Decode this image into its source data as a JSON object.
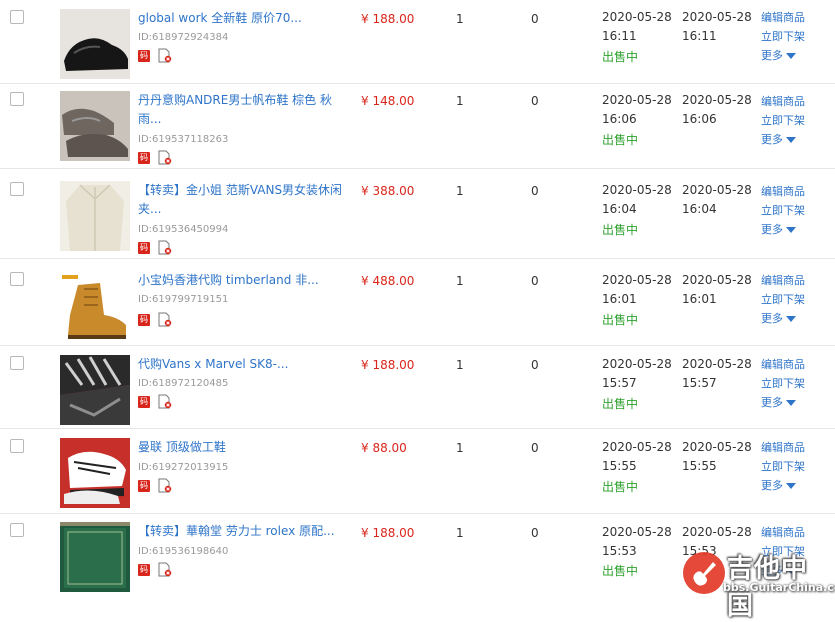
{
  "colors": {
    "link": "#2e74c9",
    "price": "#d9261c",
    "status": "#2ea12e",
    "id": "#9a9a9a",
    "badge": "#d9261c"
  },
  "icons": {
    "badge": "code-badge-icon",
    "docx": "document-delete-icon",
    "more": "chevron-down-icon"
  },
  "badge_text": "码",
  "rows": [
    {
      "title_line1": "global work 全新鞋 原价70...",
      "title_line2": "",
      "id": "ID:618972924384",
      "price": "¥ 188.00",
      "qty": "1",
      "sold": "0",
      "created_date": "2020-05-28",
      "created_time": "16:11",
      "updated_date": "2020-05-28",
      "updated_time": "16:11",
      "status": "出售中",
      "op_edit": "编辑商品",
      "op_offshelf": "立即下架",
      "op_more": "更多"
    },
    {
      "title_line1": "丹丹意购ANDRE男士帆布鞋 棕色 秋",
      "title_line2": "雨...",
      "id": "ID:619537118263",
      "price": "¥ 148.00",
      "qty": "1",
      "sold": "0",
      "created_date": "2020-05-28",
      "created_time": "16:06",
      "updated_date": "2020-05-28",
      "updated_time": "16:06",
      "status": "出售中",
      "op_edit": "编辑商品",
      "op_offshelf": "立即下架",
      "op_more": "更多"
    },
    {
      "title_line1": "【转卖】金小姐 范斯VANS男女装休闲",
      "title_line2": "夹...",
      "id": "ID:619536450994",
      "price": "¥ 388.00",
      "qty": "1",
      "sold": "0",
      "created_date": "2020-05-28",
      "created_time": "16:04",
      "updated_date": "2020-05-28",
      "updated_time": "16:04",
      "status": "出售中",
      "op_edit": "编辑商品",
      "op_offshelf": "立即下架",
      "op_more": "更多"
    },
    {
      "title_line1": "小宝妈香港代购 timberland 非...",
      "title_line2": "",
      "id": "ID:619799719151",
      "price": "¥ 488.00",
      "qty": "1",
      "sold": "0",
      "created_date": "2020-05-28",
      "created_time": "16:01",
      "updated_date": "2020-05-28",
      "updated_time": "16:01",
      "status": "出售中",
      "op_edit": "编辑商品",
      "op_offshelf": "立即下架",
      "op_more": "更多"
    },
    {
      "title_line1": "代购Vans x Marvel SK8-...",
      "title_line2": "",
      "id": "ID:618972120485",
      "price": "¥ 188.00",
      "qty": "1",
      "sold": "0",
      "created_date": "2020-05-28",
      "created_time": "15:57",
      "updated_date": "2020-05-28",
      "updated_time": "15:57",
      "status": "出售中",
      "op_edit": "编辑商品",
      "op_offshelf": "立即下架",
      "op_more": "更多"
    },
    {
      "title_line1": "曼联 顶级做工鞋",
      "title_line2": "",
      "id": "ID:619272013915",
      "price": "¥ 88.00",
      "qty": "1",
      "sold": "0",
      "created_date": "2020-05-28",
      "created_time": "15:55",
      "updated_date": "2020-05-28",
      "updated_time": "15:55",
      "status": "出售中",
      "op_edit": "编辑商品",
      "op_offshelf": "立即下架",
      "op_more": "更多"
    },
    {
      "title_line1": "【转卖】華翰堂 劳力士 rolex 原配...",
      "title_line2": "",
      "id": "ID:619536198640",
      "price": "¥ 188.00",
      "qty": "1",
      "sold": "0",
      "created_date": "2020-05-28",
      "created_time": "15:53",
      "updated_date": "2020-05-28",
      "updated_time": "15:53",
      "status": "出售中",
      "op_edit": "编辑商品",
      "op_offshelf": "立即下架",
      "op_more": "更多"
    }
  ],
  "watermark": {
    "title": "吉他中国",
    "url": "bbs.GuitarChina.com"
  }
}
